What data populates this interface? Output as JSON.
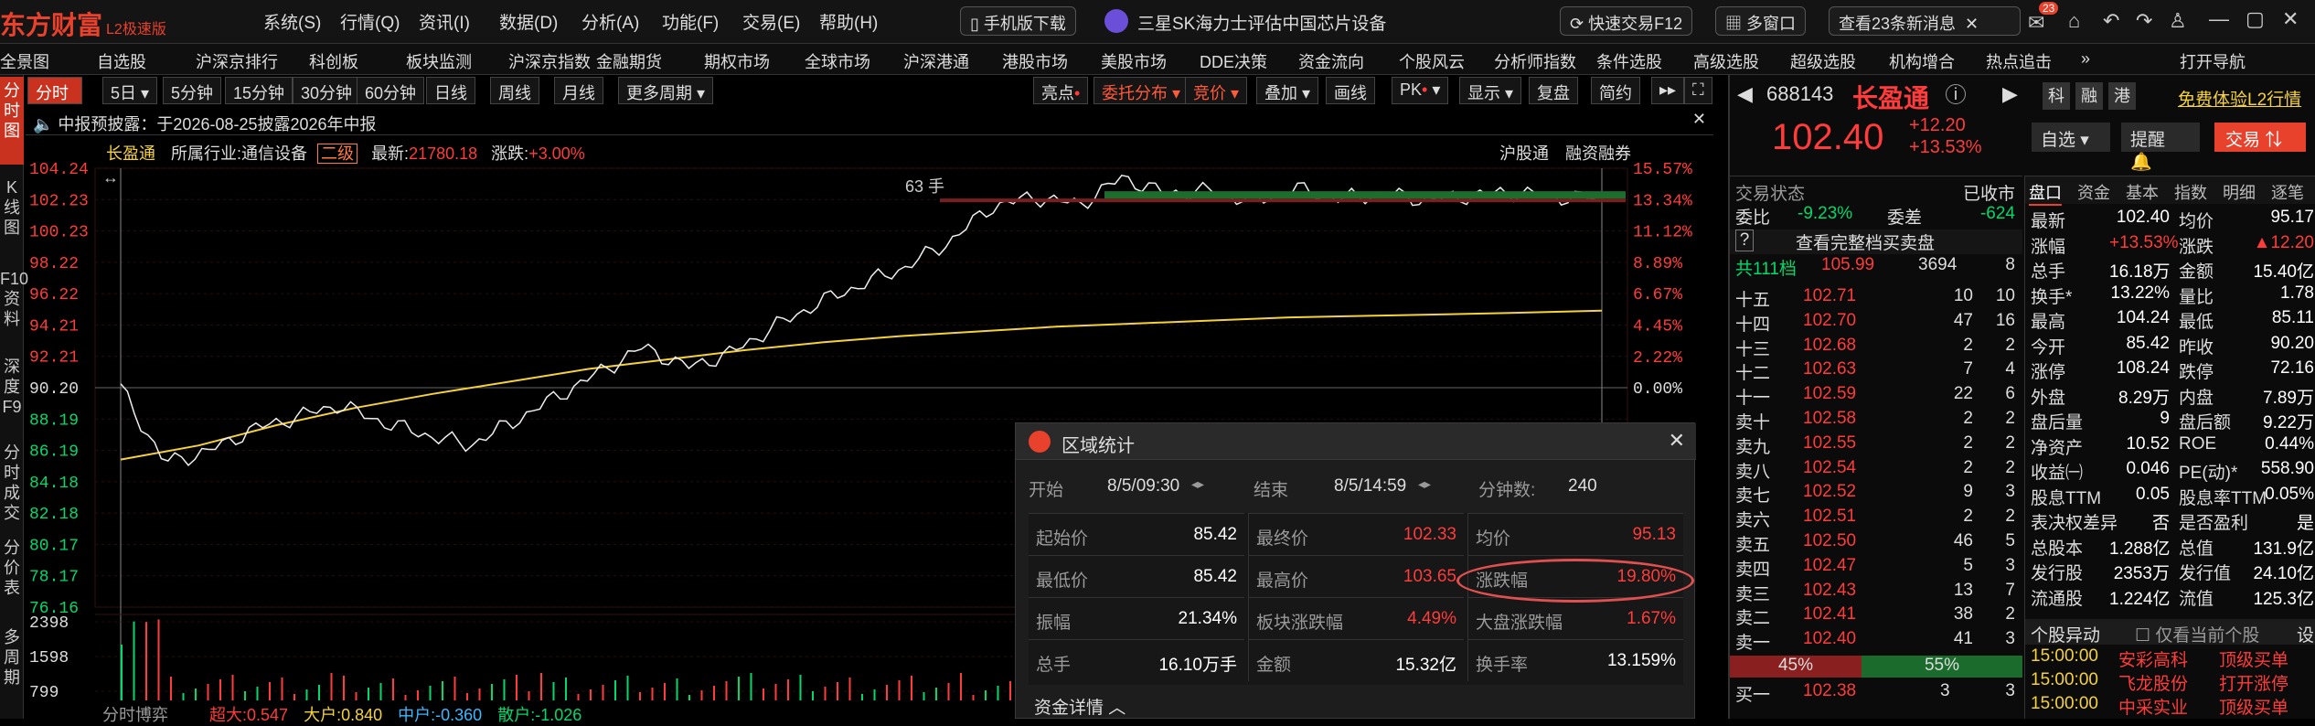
{
  "app": {
    "logo": "东方财富",
    "logo_sub": "L2极速版"
  },
  "menu": [
    "系统(S)",
    "行情(Q)",
    "资讯(I)",
    "数据(D)",
    "分析(A)",
    "功能(F)",
    "交易(E)",
    "帮助(H)"
  ],
  "topbar": {
    "mobile": "手机版下载",
    "news_ticker": "三星SK海力士评估中国芯片设备",
    "quick_trade": "快速交易F12",
    "multi_window": "多窗口",
    "msg_count_text": "查看23条新消息",
    "badge": "23"
  },
  "nav": [
    "全景图",
    "自选股",
    "沪深京排行",
    "科创板",
    "板块监测",
    "沪深京指数",
    "金融期货",
    "期权市场",
    "全球市场",
    "沪深港通",
    "港股市场",
    "美股市场",
    "DDE决策",
    "资金流向",
    "个股风云",
    "分析师指数",
    "条件选股",
    "高级选股",
    "超级选股",
    "机构增合",
    "热点追击",
    "打开导航"
  ],
  "vtabs": [
    "分时图",
    "K线图",
    "F10资料",
    "深度F9",
    "分时成交",
    "分价表",
    "多周期"
  ],
  "chart_toolbar": {
    "periods": [
      "分时",
      "5日",
      "5分钟",
      "15分钟",
      "30分钟",
      "60分钟",
      "日线",
      "周线",
      "月线",
      "更多周期"
    ],
    "right": [
      "亮点",
      "委托分布",
      "竞价",
      "叠加",
      "画线",
      "PK",
      "显示",
      "复盘",
      "简约"
    ]
  },
  "notice": "中报预披露：于2026-08-25披露2026年中报",
  "info": {
    "name": "长盈通",
    "industry_label": "所属行业:",
    "industry": "通信设备",
    "level": "二级",
    "latest_label": "最新:",
    "latest": "21780.18",
    "change_label": "涨跌:",
    "change": "+3.00%",
    "tags": [
      "沪股通",
      "融资融券"
    ]
  },
  "chart_data": {
    "type": "line",
    "title": "长盈通",
    "price_ticks": [
      "104.24",
      "102.23",
      "100.23",
      "98.22",
      "96.22",
      "94.21",
      "92.21",
      "90.20",
      "88.19",
      "86.19",
      "84.18",
      "82.18",
      "80.17",
      "78.17",
      "76.16"
    ],
    "pct_ticks": [
      "15.57%",
      "13.34%",
      "11.12%",
      "8.89%",
      "6.67%",
      "4.45%",
      "2.22%",
      "0.00%"
    ],
    "volume_ticks": [
      "2398",
      "1598",
      "799"
    ],
    "prev_close": 90.2,
    "annotation": "63 手",
    "series": [
      {
        "name": "价格",
        "values": [
          90.2,
          85.42,
          86.1,
          87.5,
          88.3,
          89.1,
          88.0,
          87.2,
          86.5,
          88.0,
          89.6,
          91.2,
          92.8,
          91.5,
          92.4,
          94.1,
          95.6,
          96.8,
          97.9,
          99.5,
          101.8,
          102.4,
          101.9,
          103.65,
          102.6,
          102.8,
          102.1,
          102.9,
          102.3,
          102.6,
          102.2,
          102.5,
          102.7,
          102.4,
          102.33
        ]
      },
      {
        "name": "均价",
        "values": [
          85.6,
          86.5,
          87.8,
          88.9,
          89.8,
          90.6,
          91.4,
          92.0,
          92.6,
          93.1,
          93.5,
          93.8,
          94.1,
          94.3,
          94.5,
          94.7,
          94.8,
          94.9,
          95.0,
          95.13
        ]
      }
    ]
  },
  "bottom_bar": {
    "label": "分时博弈",
    "items": [
      "超大:0.547",
      "大户:0.840",
      "中户:-0.360",
      "散户:-1.026"
    ]
  },
  "dialog": {
    "title": "区域统计",
    "start_label": "开始",
    "start": "8/5/09:30",
    "end_label": "结束",
    "end": "8/5/14:59",
    "minutes_label": "分钟数:",
    "minutes": "240",
    "rows": [
      [
        "起始价",
        "85.42",
        "最终价",
        "102.33",
        "均价",
        "95.13"
      ],
      [
        "最低价",
        "85.42",
        "最高价",
        "103.65",
        "涨跌幅",
        "19.80%"
      ],
      [
        "振幅",
        "21.34%",
        "板块涨跌幅",
        "4.49%",
        "大盘涨跌幅",
        "1.67%"
      ],
      [
        "总手",
        "16.10万手",
        "金额",
        "15.32亿",
        "换手率",
        "13.159%"
      ]
    ],
    "detail": "资金详情"
  },
  "quote": {
    "code": "688143",
    "name": "长盈通",
    "tags": [
      "科",
      "融",
      "港"
    ],
    "free_trial": "免费体验L2行情",
    "price": "102.40",
    "chg": "+12.20",
    "pct": "+13.53%",
    "btns": [
      "自选",
      "提醒",
      "交易"
    ],
    "status_label": "交易状态",
    "status": "已收市",
    "weibi_label": "委比",
    "weibi": "-9.23%",
    "weicha_label": "委差",
    "weicha": "-624",
    "full_book": "查看完整档买卖盘",
    "total": {
      "label": "共111档",
      "price": "105.99",
      "vol": "3694",
      "n": "8"
    },
    "asks": [
      [
        "十五",
        "102.71",
        "10",
        "10"
      ],
      [
        "十四",
        "102.70",
        "47",
        "16"
      ],
      [
        "十三",
        "102.68",
        "2",
        "2"
      ],
      [
        "十二",
        "102.63",
        "7",
        "4"
      ],
      [
        "十一",
        "102.59",
        "22",
        "6"
      ],
      [
        "卖十",
        "102.58",
        "2",
        "2"
      ],
      [
        "卖九",
        "102.55",
        "2",
        "2"
      ],
      [
        "卖八",
        "102.54",
        "2",
        "2"
      ],
      [
        "卖七",
        "102.52",
        "9",
        "3"
      ],
      [
        "卖六",
        "102.51",
        "2",
        "2"
      ],
      [
        "卖五",
        "102.50",
        "46",
        "5"
      ],
      [
        "卖四",
        "102.47",
        "5",
        "3"
      ],
      [
        "卖三",
        "102.43",
        "13",
        "7"
      ],
      [
        "卖二",
        "102.41",
        "38",
        "2"
      ],
      [
        "卖一",
        "102.40",
        "41",
        "3"
      ]
    ],
    "ratio": [
      "45%",
      "55%"
    ],
    "buy1": [
      "买一",
      "102.38",
      "3",
      "3"
    ]
  },
  "tabs2": [
    "盘口",
    "资金",
    "基本",
    "指数",
    "明细",
    "逐笔"
  ],
  "stats": [
    [
      "最新",
      "102.40",
      "均价",
      "95.17"
    ],
    [
      "涨幅",
      "+13.53%",
      "涨跌",
      "▲12.20"
    ],
    [
      "总手",
      "16.18万",
      "金额",
      "15.40亿"
    ],
    [
      "换手*",
      "13.22%",
      "量比",
      "1.78"
    ],
    [
      "最高",
      "104.24",
      "最低",
      "85.11"
    ],
    [
      "今开",
      "85.42",
      "昨收",
      "90.20"
    ],
    [
      "涨停",
      "108.24",
      "跌停",
      "72.16"
    ],
    [
      "外盘",
      "8.29万",
      "内盘",
      "7.89万"
    ],
    [
      "盘后量",
      "9",
      "盘后额",
      "9.22万"
    ],
    [
      "净资产",
      "10.52",
      "ROE",
      "0.44%"
    ],
    [
      "收益㈠",
      "0.046",
      "PE(动)*",
      "558.90"
    ],
    [
      "股息TTM",
      "0.05",
      "股息率TTM",
      "0.05%"
    ],
    [
      "表决权差异",
      "否",
      "是否盈利",
      "是"
    ],
    [
      "总股本",
      "1.288亿",
      "总值",
      "131.9亿"
    ],
    [
      "发行股",
      "2353万",
      "发行值",
      "24.10亿"
    ],
    [
      "流通股",
      "1.224亿",
      "流值",
      "125.3亿"
    ]
  ],
  "abnormal": {
    "title": "个股异动",
    "only_label": "仅看当前个股",
    "setup": "设",
    "rows": [
      [
        "15:00:00",
        "安彩高科",
        "顶级买单"
      ],
      [
        "15:00:00",
        "飞龙股份",
        "打开涨停"
      ],
      [
        "15:00:00",
        "中采实业",
        "顶级买单"
      ]
    ]
  },
  "colors": {
    "up": "#ff3b3b",
    "down": "#00d96b",
    "avg": "#f5d23a",
    "accent": "#e8412c"
  }
}
